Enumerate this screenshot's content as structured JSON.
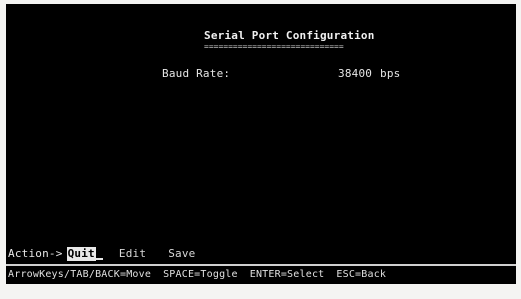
{
  "screen": {
    "title": "Serial Port Configuration",
    "title_underline": "============================="
  },
  "fields": [
    {
      "label": "Baud Rate:",
      "value": "38400",
      "unit": "bps"
    }
  ],
  "action_bar": {
    "prompt": "Action->",
    "items": [
      {
        "label": "Quit",
        "selected": true
      },
      {
        "label": "Edit",
        "selected": false
      },
      {
        "label": "Save",
        "selected": false
      }
    ]
  },
  "help": {
    "items": [
      "ArrowKeys/TAB/BACK=Move",
      "SPACE=Toggle",
      "ENTER=Select",
      "ESC=Back"
    ]
  },
  "colors": {
    "background": "#000000",
    "foreground": "#e6e6e6",
    "highlight_bg": "#e8e8e8",
    "highlight_fg": "#000000",
    "frame": "#f4f4f2"
  }
}
